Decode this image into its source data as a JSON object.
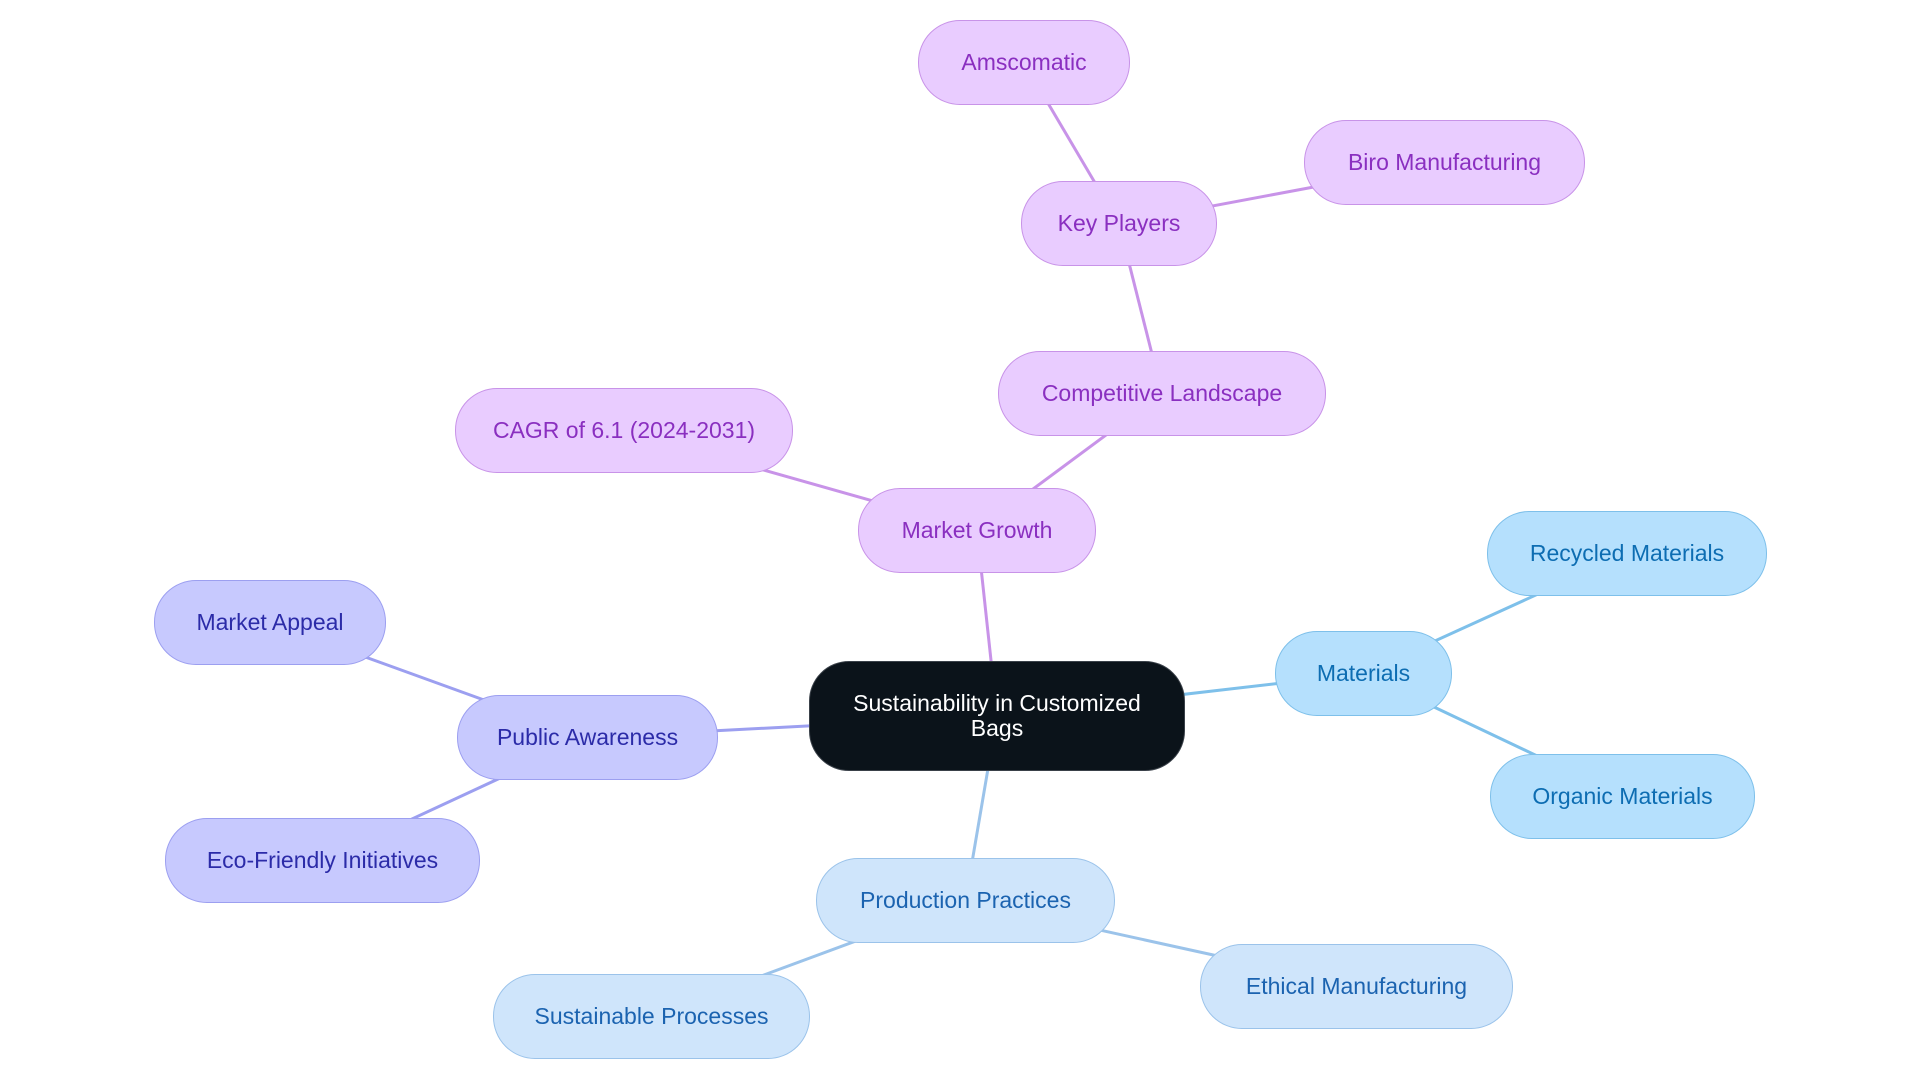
{
  "title": "Sustainability in Customized Bags",
  "palette": {
    "root": {
      "fill": "#0b131a",
      "stroke": "#3a4149",
      "text": "#ffffff",
      "edge": "#000000"
    },
    "purple": {
      "fill": "#e9ccff",
      "stroke": "#c893e8",
      "text": "#8a2fc0",
      "edge": "#c893e8"
    },
    "indigo": {
      "fill": "#c7c9fe",
      "stroke": "#9c9ff0",
      "text": "#2b2ba8",
      "edge": "#9c9ff0"
    },
    "sky": {
      "fill": "#b5e0fd",
      "stroke": "#7ec0ea",
      "text": "#0d6db2",
      "edge": "#7ec0ea"
    },
    "blue": {
      "fill": "#cfe5fb",
      "stroke": "#9bc3ea",
      "text": "#1b63b0",
      "edge": "#9bc3ea"
    }
  },
  "nodes": [
    {
      "id": "root",
      "label": "Sustainability in Customized Bags",
      "theme": "root",
      "parent": null
    },
    {
      "id": "market-growth",
      "label": "Market Growth",
      "theme": "purple",
      "parent": "root"
    },
    {
      "id": "competitive-landscape",
      "label": "Competitive Landscape",
      "theme": "purple",
      "parent": "market-growth"
    },
    {
      "id": "key-players",
      "label": "Key Players",
      "theme": "purple",
      "parent": "competitive-landscape"
    },
    {
      "id": "amscomatic",
      "label": "Amscomatic",
      "theme": "purple",
      "parent": "key-players"
    },
    {
      "id": "biro-manufacturing",
      "label": "Biro Manufacturing",
      "theme": "purple",
      "parent": "key-players"
    },
    {
      "id": "cagr",
      "label": "CAGR of 6.1 (2024-2031)",
      "theme": "purple",
      "parent": "market-growth"
    },
    {
      "id": "public-awareness",
      "label": "Public Awareness",
      "theme": "indigo",
      "parent": "root"
    },
    {
      "id": "market-appeal",
      "label": "Market Appeal",
      "theme": "indigo",
      "parent": "public-awareness"
    },
    {
      "id": "eco-friendly-initiatives",
      "label": "Eco-Friendly Initiatives",
      "theme": "indigo",
      "parent": "public-awareness"
    },
    {
      "id": "materials",
      "label": "Materials",
      "theme": "sky",
      "parent": "root"
    },
    {
      "id": "recycled-materials",
      "label": "Recycled Materials",
      "theme": "sky",
      "parent": "materials"
    },
    {
      "id": "organic-materials",
      "label": "Organic Materials",
      "theme": "sky",
      "parent": "materials"
    },
    {
      "id": "production-practices",
      "label": "Production Practices",
      "theme": "blue",
      "parent": "root"
    },
    {
      "id": "ethical-manufacturing",
      "label": "Ethical Manufacturing",
      "theme": "blue",
      "parent": "production-practices"
    },
    {
      "id": "sustainable-processes",
      "label": "Sustainable Processes",
      "theme": "blue",
      "parent": "production-practices"
    }
  ]
}
